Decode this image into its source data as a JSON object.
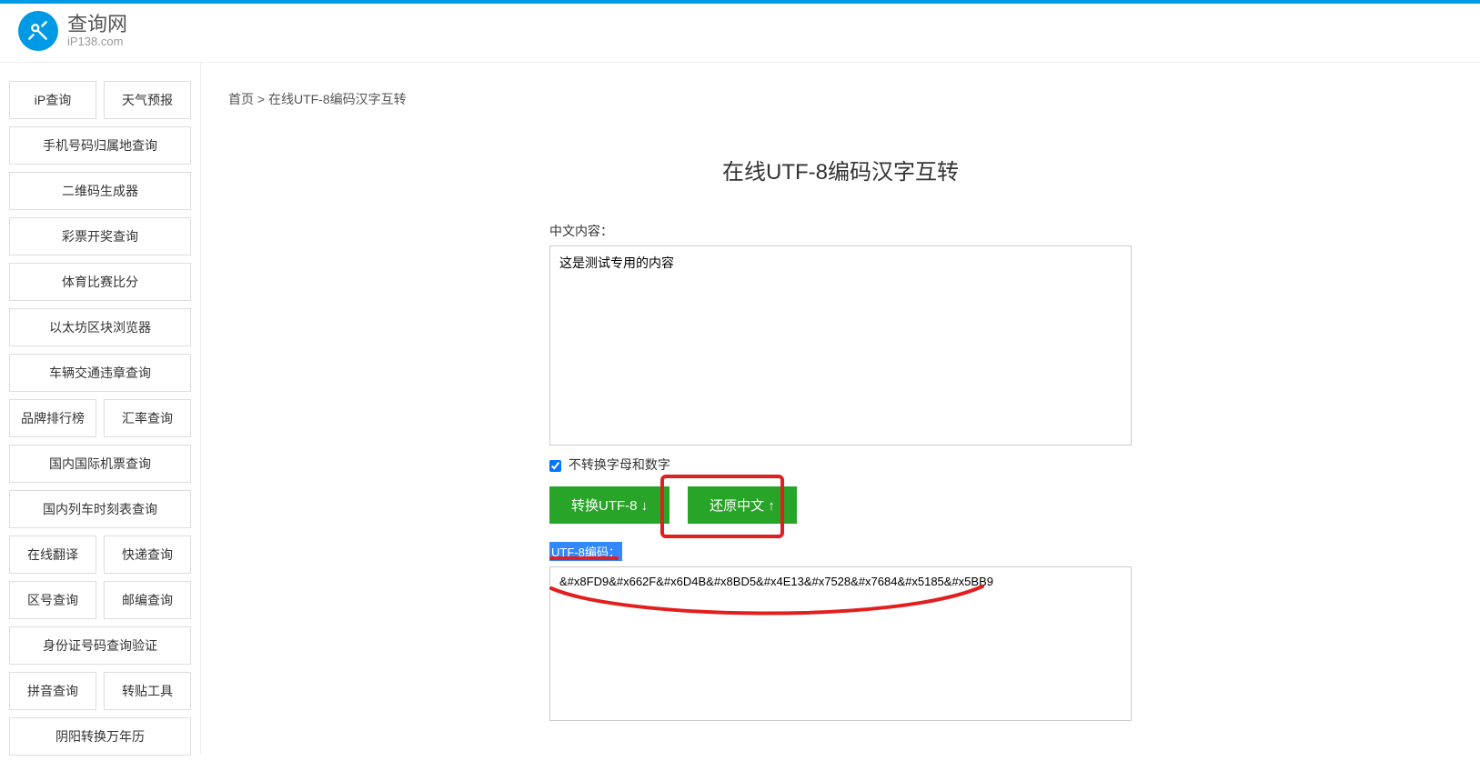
{
  "brand": {
    "title": "查询网",
    "sub": "iP138.com"
  },
  "sidebar": {
    "rows": [
      [
        "iP查询",
        "天气预报"
      ],
      [
        "手机号码归属地查询"
      ],
      [
        "二维码生成器"
      ],
      [
        "彩票开奖查询"
      ],
      [
        "体育比赛比分"
      ],
      [
        "以太坊区块浏览器"
      ],
      [
        "车辆交通违章查询"
      ],
      [
        "品牌排行榜",
        "汇率查询"
      ],
      [
        "国内国际机票查询"
      ],
      [
        "国内列车时刻表查询"
      ],
      [
        "在线翻译",
        "快递查询"
      ],
      [
        "区号查询",
        "邮编查询"
      ],
      [
        "身份证号码查询验证"
      ],
      [
        "拼音查询",
        "转贴工具"
      ],
      [
        "阴阳转换万年历"
      ]
    ]
  },
  "breadcrumb": {
    "home": "首页",
    "sep": " > ",
    "current": "在线UTF-8编码汉字互转"
  },
  "page": {
    "title": "在线UTF-8编码汉字互转"
  },
  "input": {
    "label": "中文内容：",
    "value": "这是测试专用的内容"
  },
  "checkbox": {
    "label": "不转换字母和数字",
    "checked": true
  },
  "buttons": {
    "encode": "转换UTF-8 ↓",
    "decode": "还原中文 ↑"
  },
  "output": {
    "label": "UTF-8编码：",
    "value": "&#x8FD9&#x662F&#x6D4B&#x8BD5&#x4E13&#x7528&#x7684&#x5185&#x5BB9"
  }
}
